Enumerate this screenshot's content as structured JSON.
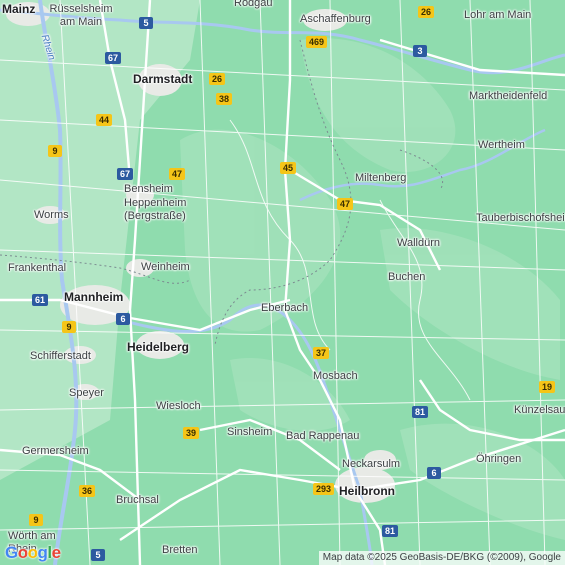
{
  "map": {
    "places": [
      {
        "name": "Mainz",
        "major": true
      },
      {
        "name": "Rüsselsheim am Main",
        "major": false
      },
      {
        "name": "Rodgau",
        "major": false
      },
      {
        "name": "Aschaffenburg",
        "major": false
      },
      {
        "name": "Lohr am Main",
        "major": false
      },
      {
        "name": "Darmstadt",
        "major": true
      },
      {
        "name": "Marktheidenfeld",
        "major": false
      },
      {
        "name": "Wertheim",
        "major": false
      },
      {
        "name": "Bensheim",
        "major": false
      },
      {
        "name": "Heppenheim (Bergstraße)",
        "major": false
      },
      {
        "name": "Miltenberg",
        "major": false
      },
      {
        "name": "Worms",
        "major": false
      },
      {
        "name": "Tauberbischofsheim",
        "major": false
      },
      {
        "name": "Walldürn",
        "major": false
      },
      {
        "name": "Frankenthal",
        "major": false
      },
      {
        "name": "Weinheim",
        "major": false
      },
      {
        "name": "Buchen",
        "major": false
      },
      {
        "name": "Mannheim",
        "major": true
      },
      {
        "name": "Eberbach",
        "major": false
      },
      {
        "name": "Schifferstadt",
        "major": false
      },
      {
        "name": "Heidelberg",
        "major": true
      },
      {
        "name": "Mosbach",
        "major": false
      },
      {
        "name": "Speyer",
        "major": false
      },
      {
        "name": "Wiesloch",
        "major": false
      },
      {
        "name": "Künzelsau",
        "major": false
      },
      {
        "name": "Sinsheim",
        "major": false
      },
      {
        "name": "Bad Rappenau",
        "major": false
      },
      {
        "name": "Germersheim",
        "major": false
      },
      {
        "name": "Neckarsulm",
        "major": false
      },
      {
        "name": "Öhringen",
        "major": false
      },
      {
        "name": "Heilbronn",
        "major": true
      },
      {
        "name": "Bruchsal",
        "major": false
      },
      {
        "name": "Wörth am Rhein",
        "major": false
      },
      {
        "name": "Bretten",
        "major": false
      }
    ],
    "water_labels": [
      "Rhein"
    ],
    "shields": [
      {
        "label": "5",
        "type": "a"
      },
      {
        "label": "26",
        "type": "b"
      },
      {
        "label": "469",
        "type": "b"
      },
      {
        "label": "67",
        "type": "a"
      },
      {
        "label": "26",
        "type": "b"
      },
      {
        "label": "3",
        "type": "a"
      },
      {
        "label": "38",
        "type": "b"
      },
      {
        "label": "44",
        "type": "b"
      },
      {
        "label": "9",
        "type": "b"
      },
      {
        "label": "67",
        "type": "a"
      },
      {
        "label": "47",
        "type": "b"
      },
      {
        "label": "45",
        "type": "b"
      },
      {
        "label": "47",
        "type": "b"
      },
      {
        "label": "61",
        "type": "a"
      },
      {
        "label": "6",
        "type": "a"
      },
      {
        "label": "9",
        "type": "b"
      },
      {
        "label": "37",
        "type": "b"
      },
      {
        "label": "19",
        "type": "b"
      },
      {
        "label": "81",
        "type": "a"
      },
      {
        "label": "39",
        "type": "b"
      },
      {
        "label": "6",
        "type": "a"
      },
      {
        "label": "36",
        "type": "b"
      },
      {
        "label": "293",
        "type": "b"
      },
      {
        "label": "9",
        "type": "b"
      },
      {
        "label": "81",
        "type": "a"
      },
      {
        "label": "5",
        "type": "a"
      }
    ],
    "attribution": "Map data ©2025 GeoBasis-DE/BKG (©2009), Google",
    "logo_letters": [
      "G",
      "o",
      "o",
      "g",
      "l",
      "e"
    ],
    "colors": {
      "land": "#8fdcae",
      "urban": "#e8eae6",
      "water": "#a8c8f0",
      "road": "#ffffff",
      "motorway_shield": "#2c5aa0",
      "federal_shield": "#f5c518"
    }
  }
}
